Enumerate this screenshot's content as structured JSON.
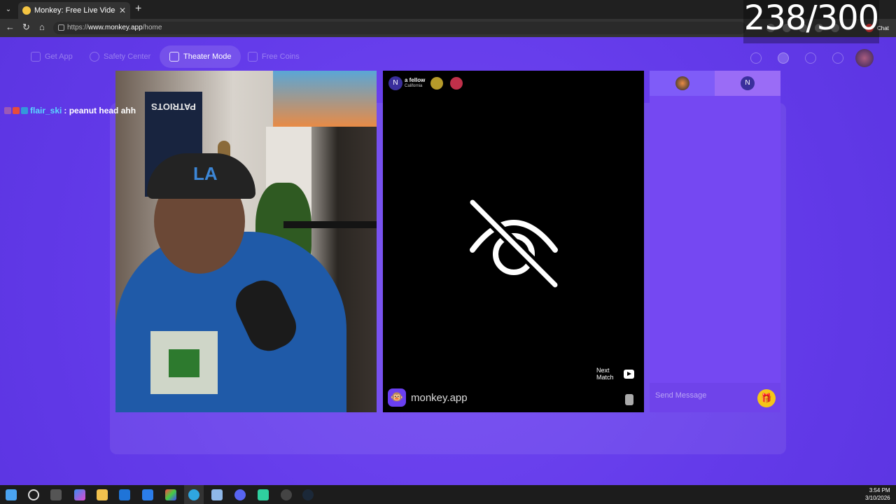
{
  "browser": {
    "tab_title": "Monkey: Free Live Video Chat",
    "tab_close": "✕",
    "new_tab": "+",
    "url_prefix": "https://",
    "url_host": "www.monkey.app",
    "url_path": "/home",
    "chat_label": "Chat"
  },
  "overlay": {
    "counter": "238/300"
  },
  "nav": {
    "get_app": "Get App",
    "safety_center": "Safety Center",
    "theater_mode": "Theater Mode",
    "free_coins": "Free Coins"
  },
  "stream_chat": {
    "username": "flair_ski",
    "message": ": peanut head ahh"
  },
  "self_video": {
    "poster_text": "PATRIOTS",
    "cap_logo": "LA"
  },
  "remote": {
    "user_initial": "N",
    "user_name": "a fellow",
    "user_location": "California",
    "next_match_line1": "Next",
    "next_match_line2": "Match",
    "brand": "monkey.app",
    "brand_logo": "🐵"
  },
  "chat": {
    "partner_initial": "N",
    "input_placeholder": "Send Message",
    "gift_icon": "🎁"
  },
  "taskbar": {
    "time": "3:54 PM",
    "date": "3/10/2026"
  },
  "colors": {
    "page_bg": "#6a3ff0",
    "chat_panel": "#7548f2",
    "username": "#5ad6ff",
    "gift": "#f5c518"
  }
}
